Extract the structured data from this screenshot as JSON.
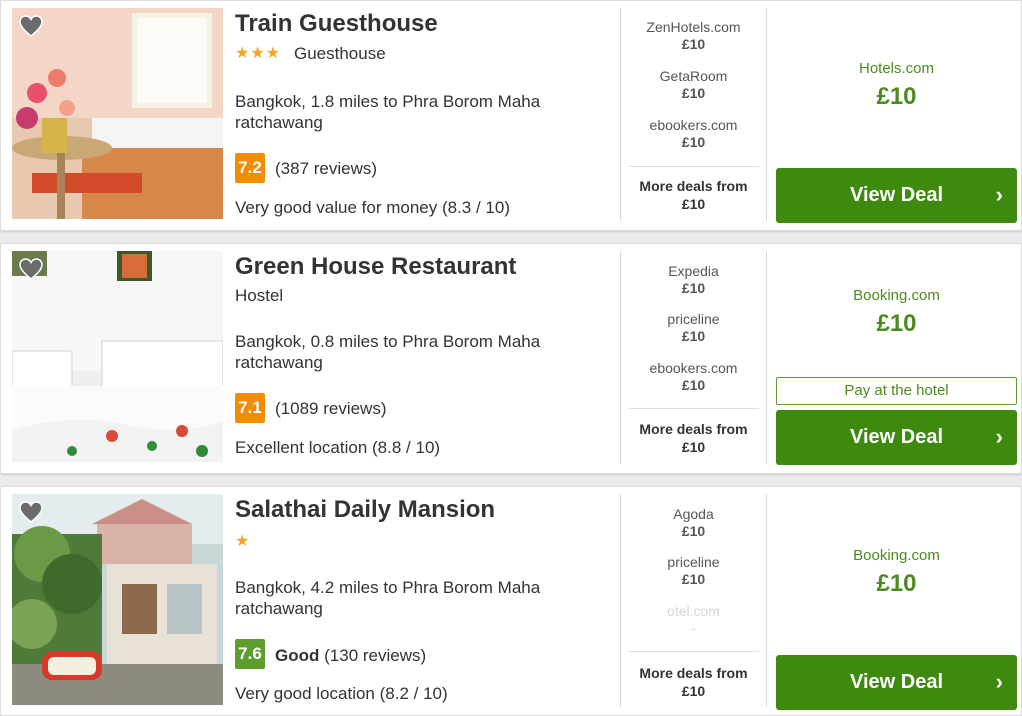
{
  "hotels": [
    {
      "name": "Train Guesthouse",
      "stars": "★★★",
      "type": "Guesthouse",
      "location": "Bangkok, 1.8 miles to Phra Borom Maha ratchawang",
      "score": "7.2",
      "score_word": "",
      "reviews": "(387 reviews)",
      "rating": "Very good value for money (8.3 / 10)",
      "deals": [
        {
          "provider": "ZenHotels.com",
          "price": "£10"
        },
        {
          "provider": "GetaRoom",
          "price": "£10"
        },
        {
          "provider": "ebookers.com",
          "price": "£10"
        }
      ],
      "more_label": "More deals from",
      "more_price": "£10",
      "best_provider": "Hotels.com",
      "best_price": "£10",
      "cta": "View Deal"
    },
    {
      "name": "Green House Restaurant",
      "type": "Hostel",
      "location": "Bangkok, 0.8 miles to Phra Borom Maha ratchawang",
      "score": "7.1",
      "reviews": "(1089 reviews)",
      "rating": "Excellent location (8.8 / 10)",
      "deals": [
        {
          "provider": "Expedia",
          "price": "£10"
        },
        {
          "provider": "priceline",
          "price": "£10"
        },
        {
          "provider": "ebookers.com",
          "price": "£10"
        }
      ],
      "more_label": "More deals from",
      "more_price": "£10",
      "best_provider": "Booking.com",
      "best_price": "£10",
      "pay_label": "Pay at the hotel",
      "cta": "View Deal"
    },
    {
      "name": "Salathai Daily Mansion",
      "stars": "★",
      "location": "Bangkok, 4.2 miles to Phra Borom Maha ratchawang",
      "score": "7.6",
      "score_word": "Good",
      "reviews": "(130 reviews)",
      "rating": "Very good location (8.2 / 10)",
      "deals": [
        {
          "provider": "Agoda",
          "price": "£10"
        },
        {
          "provider": "priceline",
          "price": "£10"
        },
        {
          "provider": "otel.com",
          "price": "-"
        }
      ],
      "more_label": "More deals from",
      "more_price": "£10",
      "best_provider": "Booking.com",
      "best_price": "£10",
      "cta": "View Deal"
    }
  ],
  "colors": {
    "accent_green": "#3e8a0f",
    "score_orange": "#f28c00",
    "score_green": "#5d9d2e",
    "star": "#f5a623"
  },
  "icons": {
    "favorite": "heart-icon",
    "chevron": "chevron-right-icon"
  }
}
